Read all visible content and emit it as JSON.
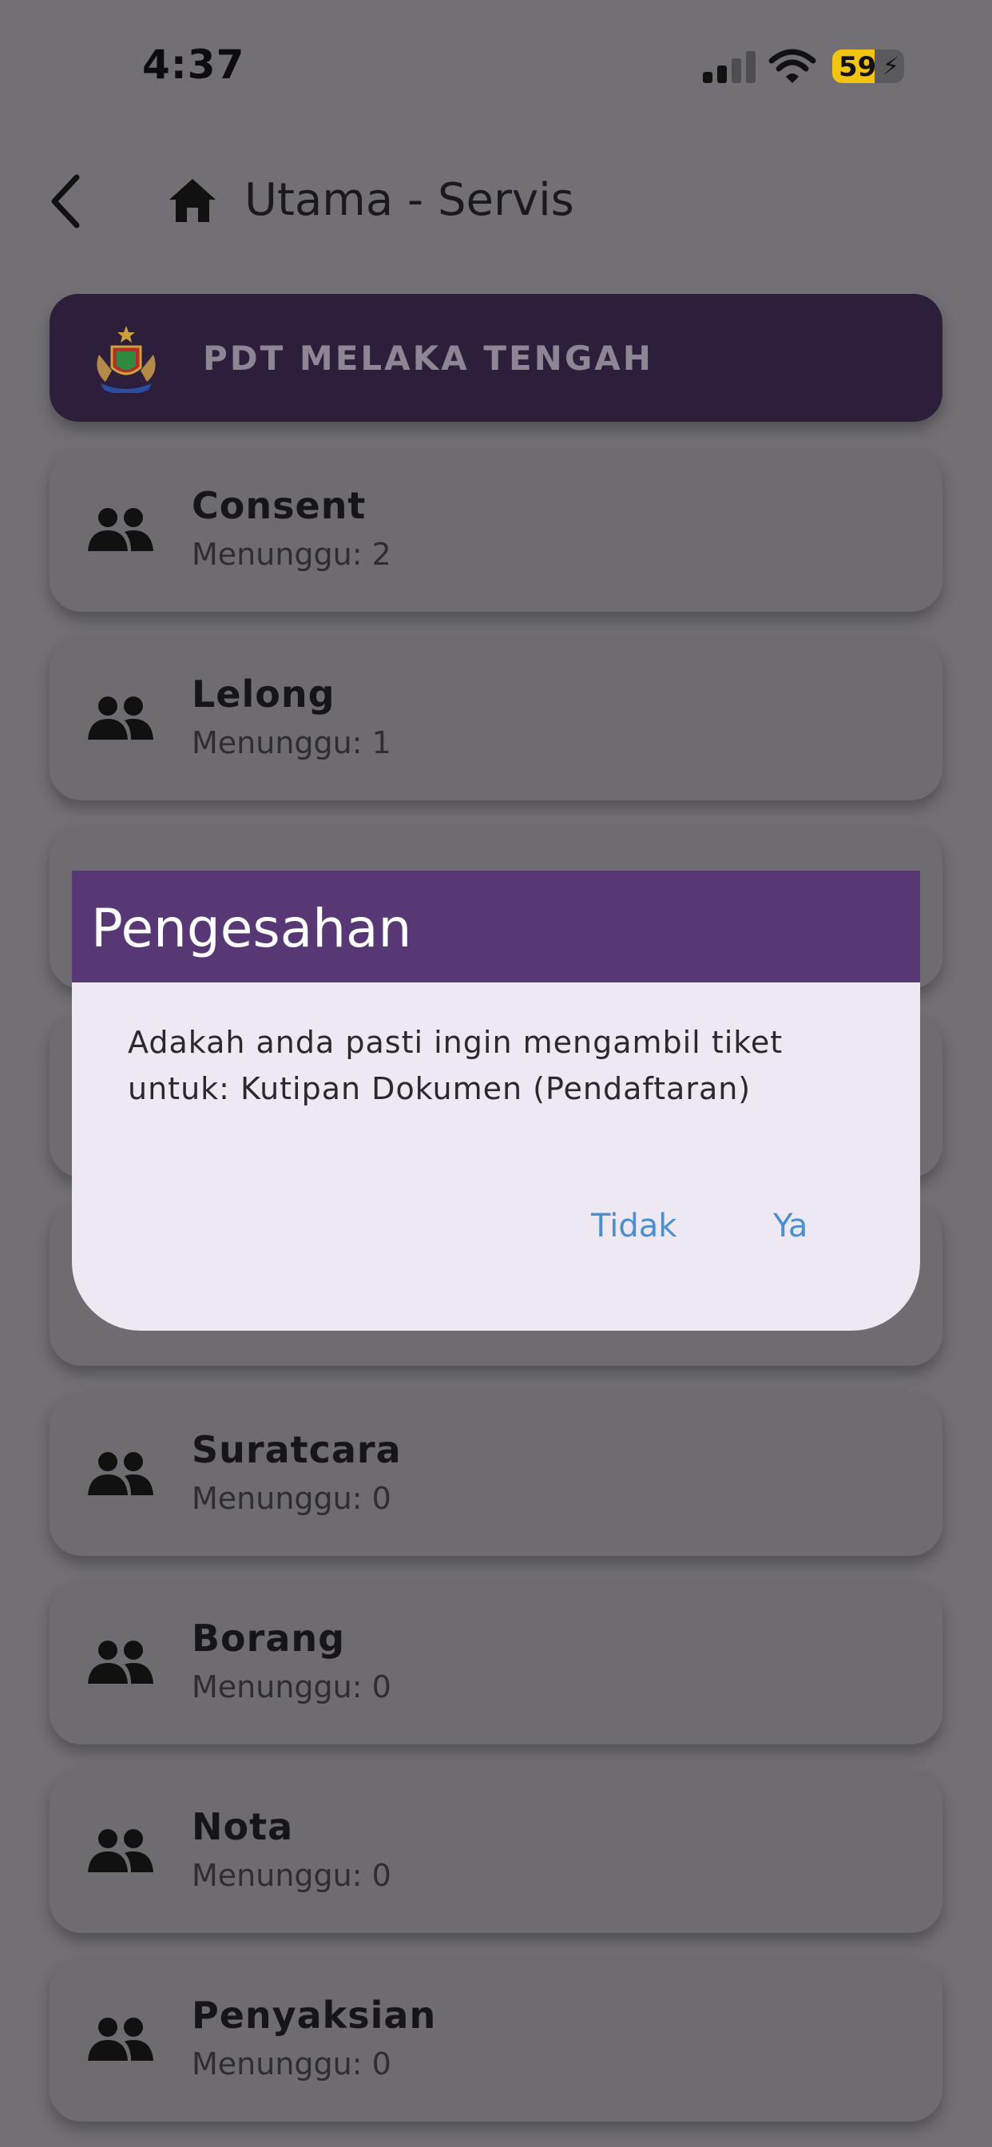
{
  "status_bar": {
    "time": "4:37",
    "battery": "59"
  },
  "header": {
    "title": "Utama - Servis"
  },
  "office": {
    "name": "PDT MELAKA TENGAH"
  },
  "services": [
    {
      "name": "Consent",
      "waiting": "Menunggu: 2"
    },
    {
      "name": "Lelong",
      "waiting": "Menunggu: 1"
    },
    {
      "name": "",
      "waiting": ""
    },
    {
      "name": "",
      "waiting": ""
    },
    {
      "name": "",
      "waiting": ""
    },
    {
      "name": "Suratcara",
      "waiting": "Menunggu: 0"
    },
    {
      "name": "Borang",
      "waiting": "Menunggu: 0"
    },
    {
      "name": "Nota",
      "waiting": "Menunggu: 0"
    },
    {
      "name": "Penyaksian",
      "waiting": "Menunggu: 0"
    }
  ],
  "dialog": {
    "title": "Pengesahan",
    "message": "Adakah anda pasti ingin mengambil tiket untuk: Kutipan Dokumen (Pendaftaran)",
    "no_label": "Tidak",
    "yes_label": "Ya"
  },
  "colors": {
    "overlay_background": "#727074",
    "banner": "#2d1f3b",
    "dialog_header": "#573875",
    "dialog_body": "#ede8f2",
    "dialog_button_text": "#4a8fd0",
    "battery": "#f1c40f"
  }
}
